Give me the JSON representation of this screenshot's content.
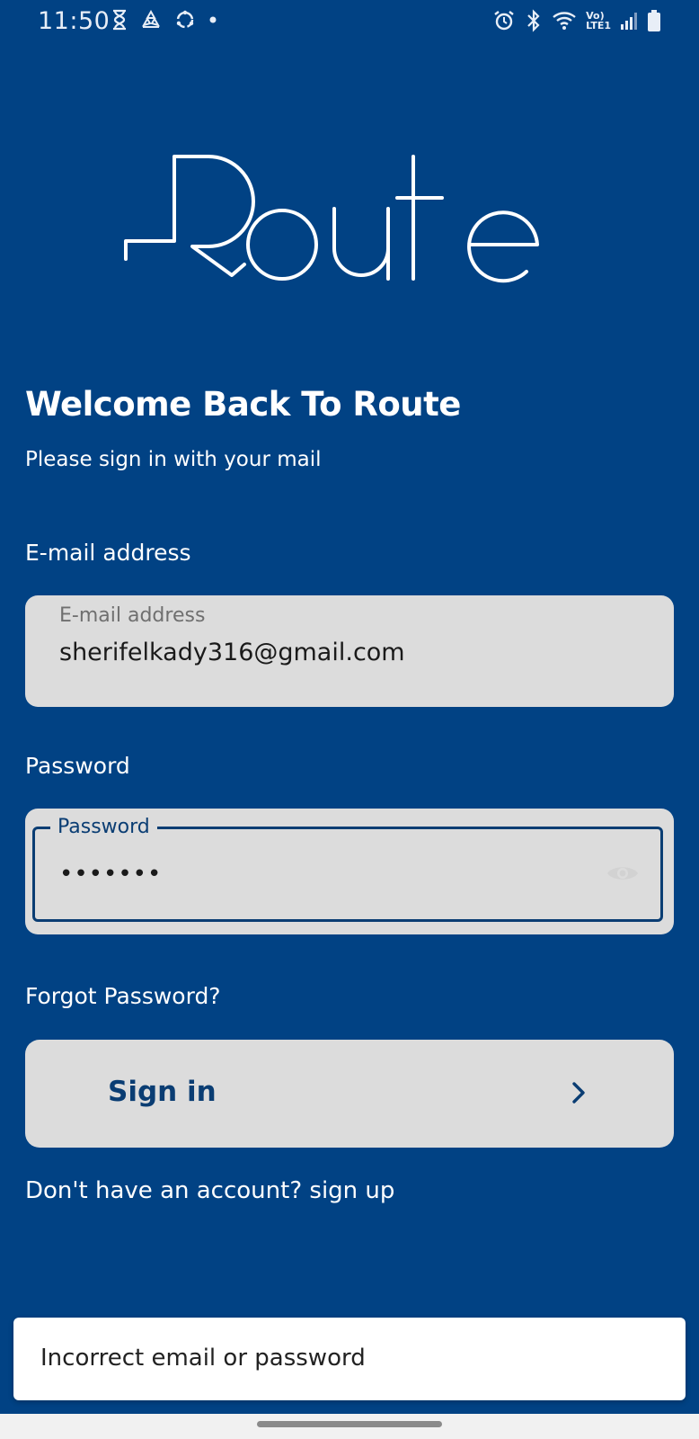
{
  "status_bar": {
    "time": "11:50",
    "left_icons": [
      "hourglass-icon",
      "recycle-icon",
      "sync-icon",
      "dot-icon"
    ],
    "right_icons": [
      "alarm-icon",
      "bluetooth-icon",
      "wifi-icon",
      "volte-icon",
      "signal-icon",
      "battery-icon"
    ],
    "volte_line1": "Vo)",
    "volte_line2": "LTE1"
  },
  "logo": {
    "brand": "Route",
    "color": "#ffffff"
  },
  "header": {
    "title": "Welcome Back To Route",
    "subtitle": "Please sign in with your mail"
  },
  "form": {
    "email": {
      "label": "E-mail address",
      "floating_label": "E-mail address",
      "value": "sherifelkady316@gmail.com"
    },
    "password": {
      "label": "Password",
      "floating_label": "Password",
      "value": "•••••••",
      "visibility_icon": "eye-icon"
    },
    "forgot_password": "Forgot Password?",
    "submit_label": "Sign in",
    "submit_icon": "chevron-right-icon",
    "signup_prompt": "Don't have an account? sign up"
  },
  "snackbar": {
    "message": "Incorrect email or password"
  },
  "colors": {
    "background": "#014284",
    "field_background": "#dcdcdc",
    "accent": "#0a3d73",
    "text_on_dark": "#ffffff"
  }
}
